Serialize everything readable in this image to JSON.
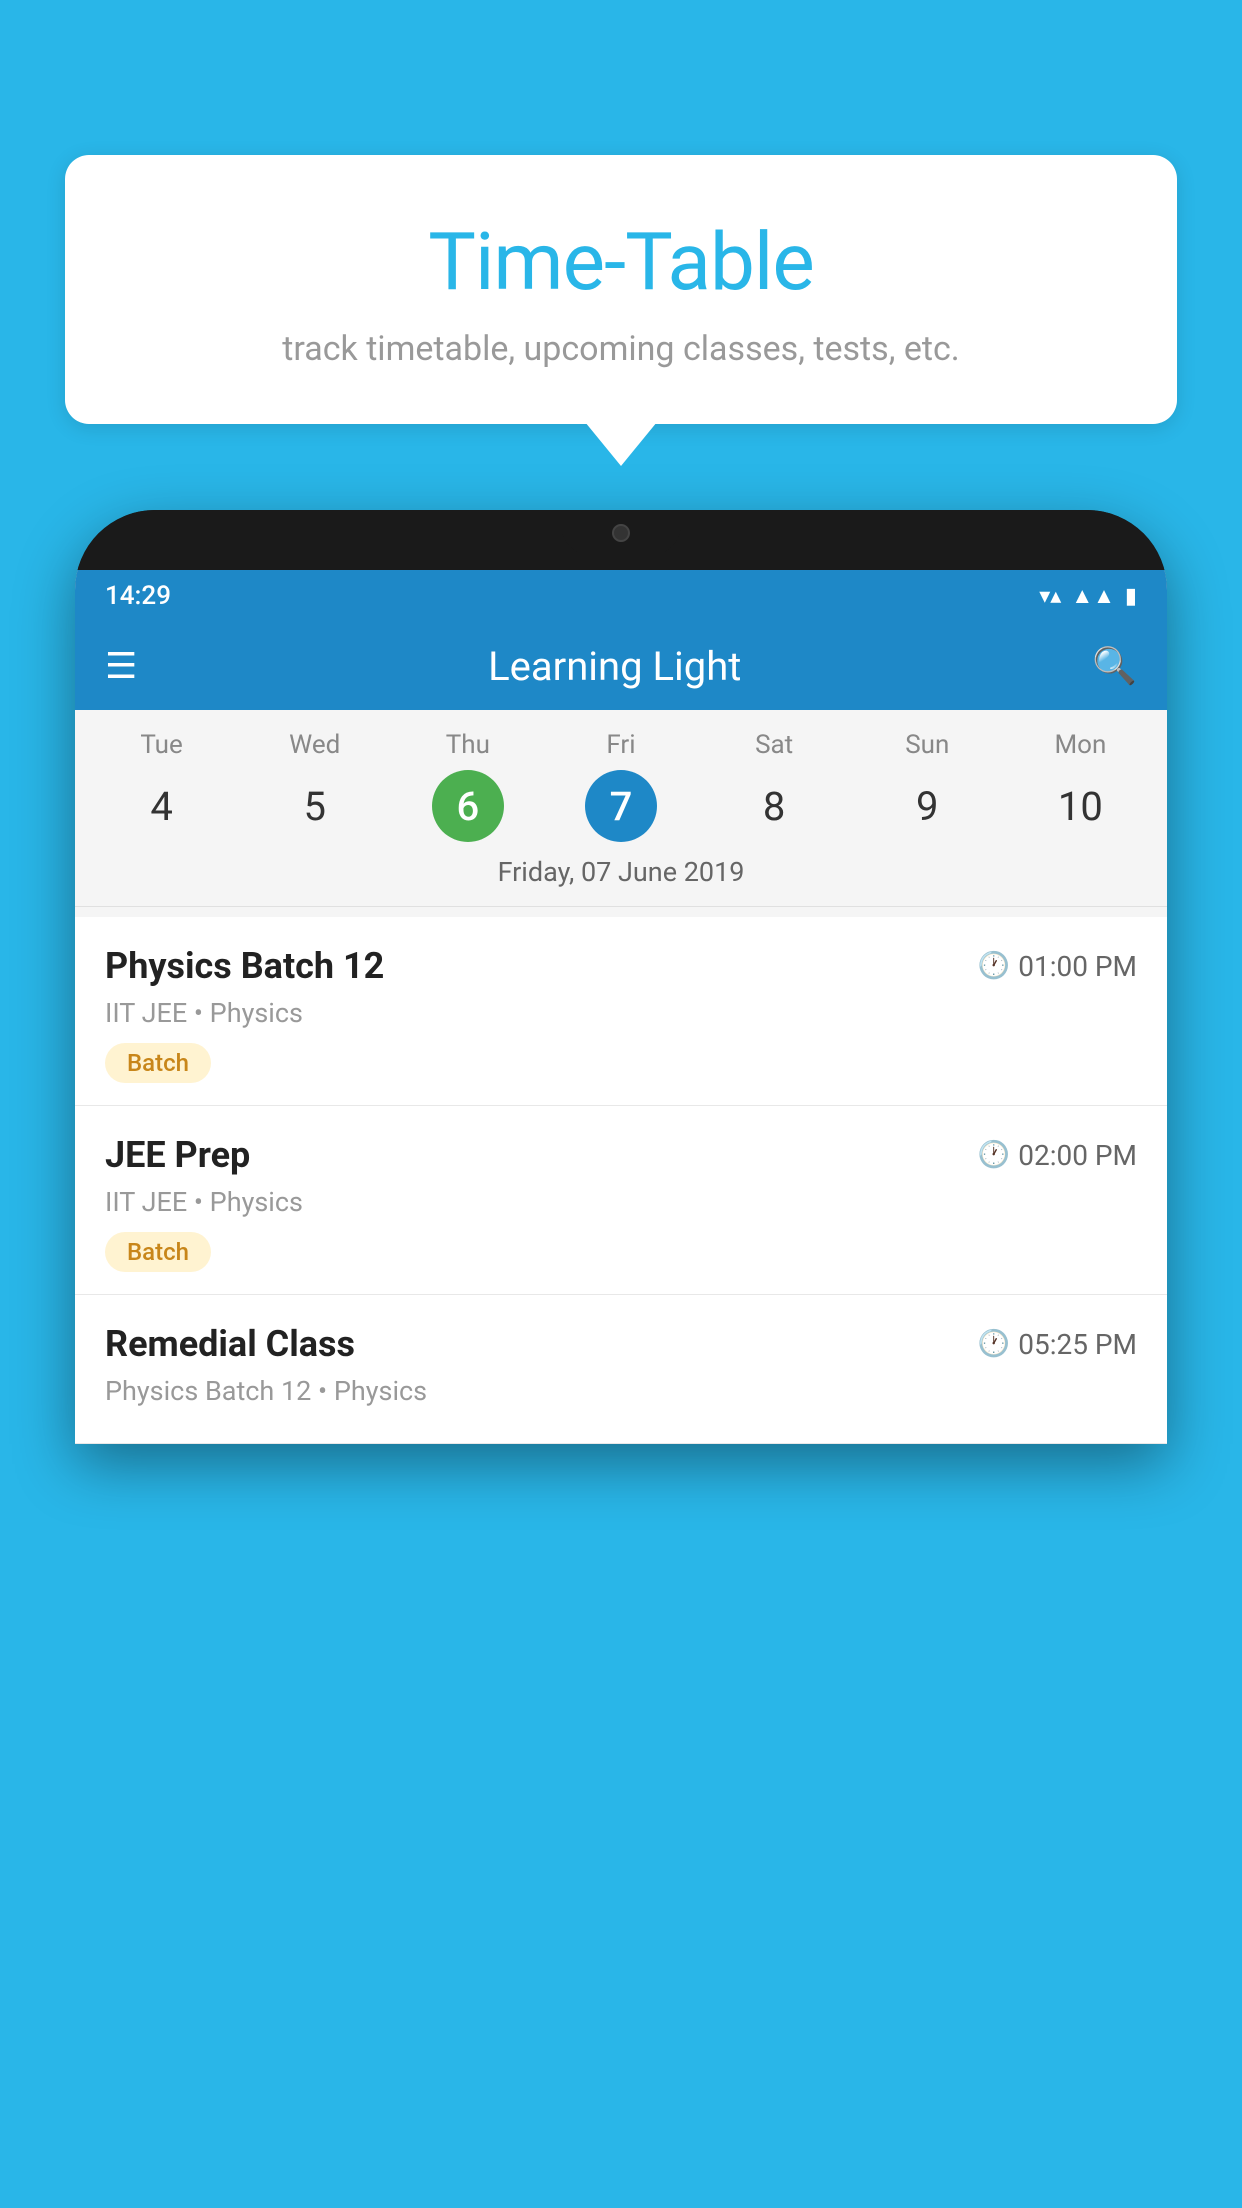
{
  "background_color": "#29b6e8",
  "bubble": {
    "title": "Time-Table",
    "subtitle": "track timetable, upcoming classes, tests, etc."
  },
  "phone": {
    "status_bar": {
      "time": "14:29"
    },
    "app_bar": {
      "title": "Learning Light"
    },
    "calendar": {
      "days": [
        {
          "name": "Tue",
          "num": "4",
          "state": "normal"
        },
        {
          "name": "Wed",
          "num": "5",
          "state": "normal"
        },
        {
          "name": "Thu",
          "num": "6",
          "state": "today"
        },
        {
          "name": "Fri",
          "num": "7",
          "state": "selected"
        },
        {
          "name": "Sat",
          "num": "8",
          "state": "normal"
        },
        {
          "name": "Sun",
          "num": "9",
          "state": "normal"
        },
        {
          "name": "Mon",
          "num": "10",
          "state": "normal"
        }
      ],
      "selected_date": "Friday, 07 June 2019"
    },
    "schedule": [
      {
        "title": "Physics Batch 12",
        "time": "01:00 PM",
        "subtitle": "IIT JEE • Physics",
        "badge": "Batch"
      },
      {
        "title": "JEE Prep",
        "time": "02:00 PM",
        "subtitle": "IIT JEE • Physics",
        "badge": "Batch"
      },
      {
        "title": "Remedial Class",
        "time": "05:25 PM",
        "subtitle": "Physics Batch 12 • Physics",
        "badge": null
      }
    ]
  }
}
